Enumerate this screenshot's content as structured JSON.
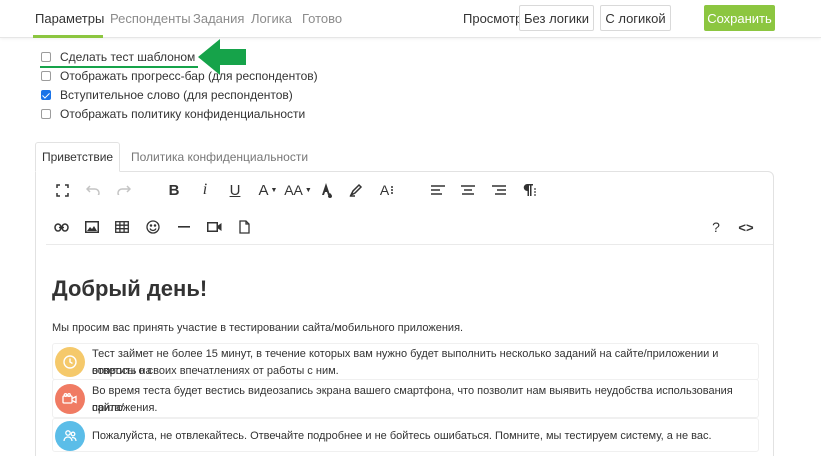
{
  "nav": {
    "tabs": [
      "Параметры",
      "Респонденты",
      "Задания",
      "Логика",
      "Готово"
    ],
    "preview_label": "Просмотр",
    "btn_no_logic": "Без логики",
    "btn_with_logic": "С логикой",
    "btn_save": "Сохранить"
  },
  "options": [
    {
      "label": "Сделать тест шаблоном",
      "checked": false
    },
    {
      "label": "Отображать прогресс-бар (для респондентов)",
      "checked": false
    },
    {
      "label": "Вступительное слово (для респондентов)",
      "checked": true
    },
    {
      "label": "Отображать политику конфиденциальности",
      "checked": false
    }
  ],
  "content_tabs": [
    "Приветствие",
    "Политика конфиденциальности"
  ],
  "toolbar": {
    "row1": [
      "fullscreen-icon",
      "undo-icon",
      "redo-icon",
      "bold-icon",
      "italic-icon",
      "underline-icon",
      "text-color-icon",
      "font-size-icon",
      "fill-color-icon",
      "highlighter-icon",
      "line-height-icon",
      "align-left-icon",
      "align-center-icon",
      "align-right-icon",
      "paragraph-icon"
    ],
    "row2": [
      "link-icon",
      "image-icon",
      "table-icon",
      "emoji-icon",
      "horizontal-line-icon",
      "video-icon",
      "file-icon",
      "help-icon",
      "code-view-icon"
    ],
    "bold": "B",
    "italic": "i",
    "underline": "U",
    "text_color": "A",
    "font_size": "AA",
    "line_height": "A",
    "help": "?",
    "code": "<>"
  },
  "editor": {
    "greeting": "Добрый день!",
    "intro": "Мы просим вас принять участие в тестировании сайта/мобильного приложения.",
    "items": [
      {
        "icon": "clock-icon",
        "color": "#f5c96b",
        "line1": "Тест займет не более 15 минут, в течение которых вам нужно будет выполнить несколько заданий на сайте/приложении и ответить на",
        "line2": "вопросы о своих впечатлениях от работы с ним."
      },
      {
        "icon": "video-camera-icon",
        "color": "#f07b63",
        "line1": "Во время теста будет вестись видеозапись экрана вашего смартфона, что позволит нам выявить неудобства использования сайта/",
        "line2": "приложения."
      },
      {
        "icon": "people-icon",
        "color": "#5bbde8",
        "line1": "Пожалуйста, не отвлекайтесь. Отвечайте подробнее и не бойтесь ошибаться. Помните, мы тестируем систему, а не вас.",
        "line2": ""
      }
    ]
  },
  "colors": {
    "accent_green": "#8cc640",
    "annotation_green": "#16a34a",
    "checkbox_blue": "#1a73e8"
  }
}
